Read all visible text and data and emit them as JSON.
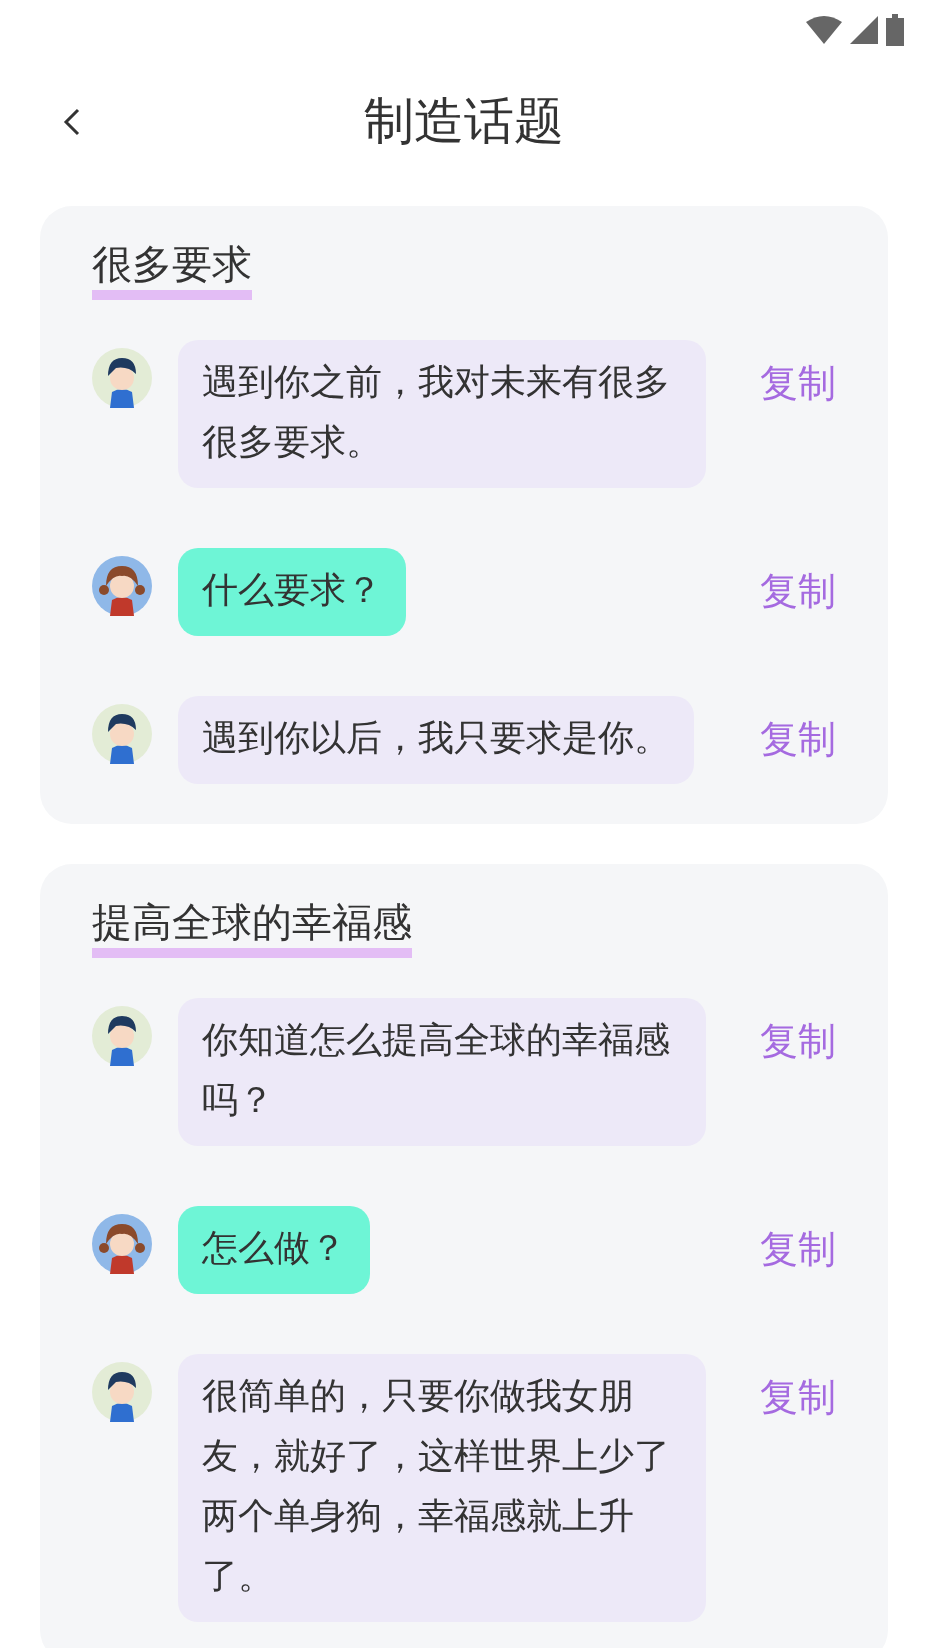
{
  "header": {
    "title": "制造话题"
  },
  "topics": [
    {
      "title": "很多要求",
      "messages": [
        {
          "kind": "boy",
          "text": "遇到你之前，我对未来有很多很多要求。",
          "action": "复制"
        },
        {
          "kind": "girl",
          "text": "什么要求？",
          "action": "复制"
        },
        {
          "kind": "boy",
          "text": "遇到你以后，我只要求是你。",
          "action": "复制"
        }
      ]
    },
    {
      "title": "提高全球的幸福感",
      "messages": [
        {
          "kind": "boy",
          "text": "你知道怎么提高全球的幸福感吗？",
          "action": "复制"
        },
        {
          "kind": "girl",
          "text": "怎么做？",
          "action": "复制"
        },
        {
          "kind": "boy",
          "text": "很简单的，只要你做我女朋友，就好了，这样世界上少了两个单身狗，幸福感就上升了。",
          "action": "复制"
        }
      ]
    }
  ]
}
